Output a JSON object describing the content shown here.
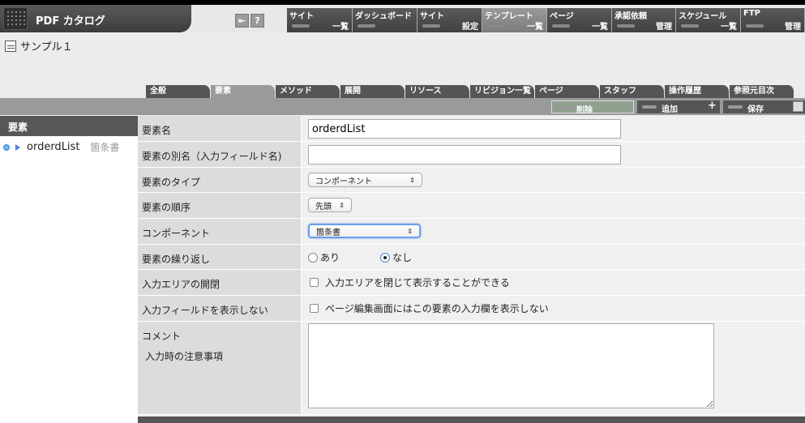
{
  "app": {
    "title": "PDF カタログ"
  },
  "toolbar": {
    "help_label": "?"
  },
  "nav": [
    {
      "top": "サイト",
      "bottom": "一覧"
    },
    {
      "top": "ダッシュボード",
      "bottom": ""
    },
    {
      "top": "サイト",
      "bottom": "設定"
    },
    {
      "top": "テンプレート",
      "bottom": "一覧"
    },
    {
      "top": "ページ",
      "bottom": "一覧"
    },
    {
      "top": "承認依頼",
      "bottom": "管理"
    },
    {
      "top": "スケジュール",
      "bottom": "一覧"
    },
    {
      "top": "FTP",
      "bottom": "管理"
    }
  ],
  "page": {
    "title": "サンプル１"
  },
  "tabs": [
    "全般",
    "要素",
    "メソッド",
    "展開",
    "リソース",
    "リビジョン一覧",
    "ページ",
    "スタッフ",
    "操作履歴",
    "参照元目次"
  ],
  "actions": {
    "delete": "削除",
    "add": "追加",
    "save": "保存"
  },
  "sidebar": {
    "heading": "要素",
    "items": [
      {
        "name": "orderdList",
        "type": "箇条書"
      }
    ]
  },
  "form": {
    "element_name": {
      "label": "要素名",
      "value": "orderdList"
    },
    "alias": {
      "label": "要素の別名（入力フィールド名)",
      "value": ""
    },
    "type": {
      "label": "要素のタイプ",
      "selected": "コンポーネント"
    },
    "order": {
      "label": "要素の順序",
      "selected": "先頭"
    },
    "component": {
      "label": "コンポーネント",
      "selected": "箇条書"
    },
    "repeat": {
      "label": "要素の繰り返し",
      "option_yes": "あり",
      "option_no": "なし",
      "selected": "なし"
    },
    "collapse": {
      "label": "入力エリアの開閉",
      "checkbox": "入力エリアを閉じて表示することができる"
    },
    "hide_field": {
      "label": "入力フィールドを表示しない",
      "checkbox": "ページ編集画面にはこの要素の入力欄を表示しない"
    },
    "comment": {
      "label": "コメント",
      "sublabel": "入力時の注意事項",
      "value": ""
    }
  }
}
